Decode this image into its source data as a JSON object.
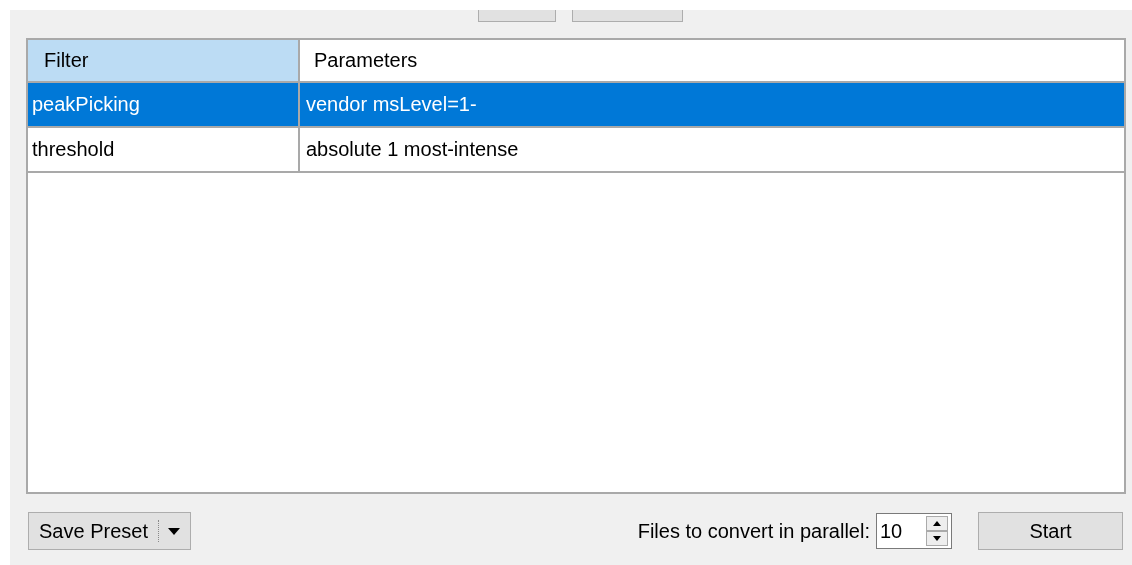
{
  "table": {
    "columns": [
      {
        "label": "Filter",
        "selected": true
      },
      {
        "label": "Parameters",
        "selected": false
      }
    ],
    "rows": [
      {
        "filter": "peakPicking",
        "parameters": "vendor msLevel=1-",
        "selected": true
      },
      {
        "filter": "threshold",
        "parameters": "absolute 1 most-intense",
        "selected": false
      }
    ]
  },
  "save_preset": {
    "label": "Save Preset"
  },
  "parallel": {
    "label": "Files to convert in parallel:",
    "value": "10"
  },
  "start_button": {
    "label": "Start"
  }
}
